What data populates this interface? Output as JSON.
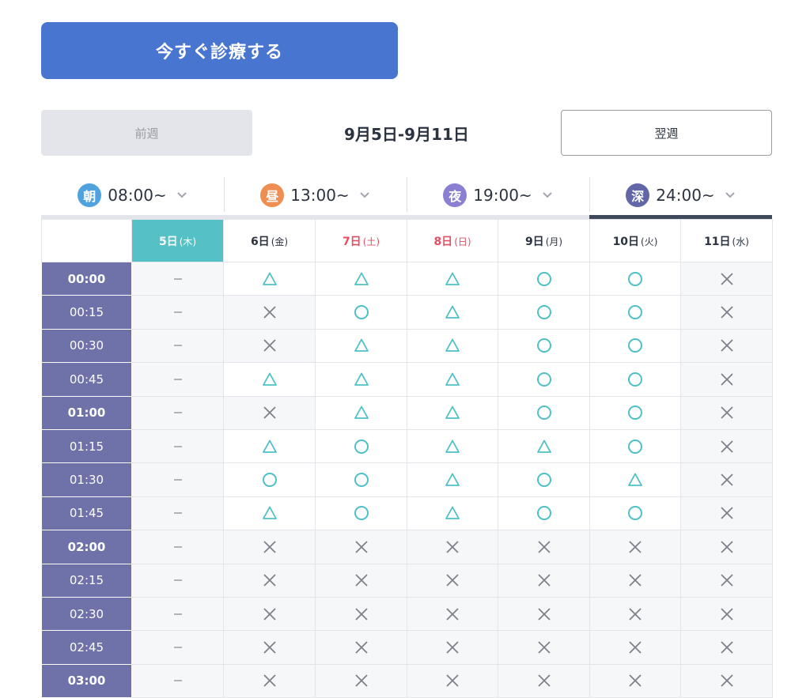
{
  "cta": {
    "label": "今すぐ診療する"
  },
  "week_nav": {
    "prev_label": "前週",
    "range": "9月5日-9月11日",
    "next_label": "翌週"
  },
  "tabs": [
    {
      "badge": "朝",
      "time": "08:00~",
      "color": "#4fa2dd",
      "active": false
    },
    {
      "badge": "昼",
      "time": "13:00~",
      "color": "#ee8e52",
      "active": false
    },
    {
      "badge": "夜",
      "time": "19:00~",
      "color": "#8a7fd2",
      "active": false
    },
    {
      "badge": "深",
      "time": "24:00~",
      "color": "#6166a8",
      "active": true
    }
  ],
  "days": [
    {
      "day": "5日",
      "dow": "(木)",
      "today": true,
      "weekend": false
    },
    {
      "day": "6日",
      "dow": "(金)",
      "today": false,
      "weekend": false
    },
    {
      "day": "7日",
      "dow": "(土)",
      "today": false,
      "weekend": true
    },
    {
      "day": "8日",
      "dow": "(日)",
      "today": false,
      "weekend": true
    },
    {
      "day": "9日",
      "dow": "(月)",
      "today": false,
      "weekend": false
    },
    {
      "day": "10日",
      "dow": "(火)",
      "today": false,
      "weekend": false
    },
    {
      "day": "11日",
      "dow": "(水)",
      "today": false,
      "weekend": false
    }
  ],
  "colors": {
    "available": "#4ec0c6",
    "unavailable": "#7f8189",
    "none": "#9a9ca4"
  },
  "rows": [
    {
      "time": "00:00",
      "hour": true,
      "cells": [
        "-",
        "△",
        "△",
        "△",
        "○",
        "○",
        "×"
      ]
    },
    {
      "time": "00:15",
      "hour": false,
      "cells": [
        "-",
        "×",
        "○",
        "△",
        "○",
        "○",
        "×"
      ]
    },
    {
      "time": "00:30",
      "hour": false,
      "cells": [
        "-",
        "×",
        "△",
        "△",
        "○",
        "○",
        "×"
      ]
    },
    {
      "time": "00:45",
      "hour": false,
      "cells": [
        "-",
        "△",
        "△",
        "△",
        "○",
        "○",
        "×"
      ]
    },
    {
      "time": "01:00",
      "hour": true,
      "cells": [
        "-",
        "×",
        "△",
        "△",
        "○",
        "○",
        "×"
      ]
    },
    {
      "time": "01:15",
      "hour": false,
      "cells": [
        "-",
        "△",
        "○",
        "△",
        "△",
        "○",
        "×"
      ]
    },
    {
      "time": "01:30",
      "hour": false,
      "cells": [
        "-",
        "○",
        "○",
        "△",
        "○",
        "△",
        "×"
      ]
    },
    {
      "time": "01:45",
      "hour": false,
      "cells": [
        "-",
        "△",
        "○",
        "△",
        "○",
        "○",
        "×"
      ]
    },
    {
      "time": "02:00",
      "hour": true,
      "cells": [
        "-",
        "×",
        "×",
        "×",
        "×",
        "×",
        "×"
      ]
    },
    {
      "time": "02:15",
      "hour": false,
      "cells": [
        "-",
        "×",
        "×",
        "×",
        "×",
        "×",
        "×"
      ]
    },
    {
      "time": "02:30",
      "hour": false,
      "cells": [
        "-",
        "×",
        "×",
        "×",
        "×",
        "×",
        "×"
      ]
    },
    {
      "time": "02:45",
      "hour": false,
      "cells": [
        "-",
        "×",
        "×",
        "×",
        "×",
        "×",
        "×"
      ]
    },
    {
      "time": "03:00",
      "hour": true,
      "cells": [
        "-",
        "×",
        "×",
        "×",
        "×",
        "×",
        "×"
      ]
    }
  ]
}
